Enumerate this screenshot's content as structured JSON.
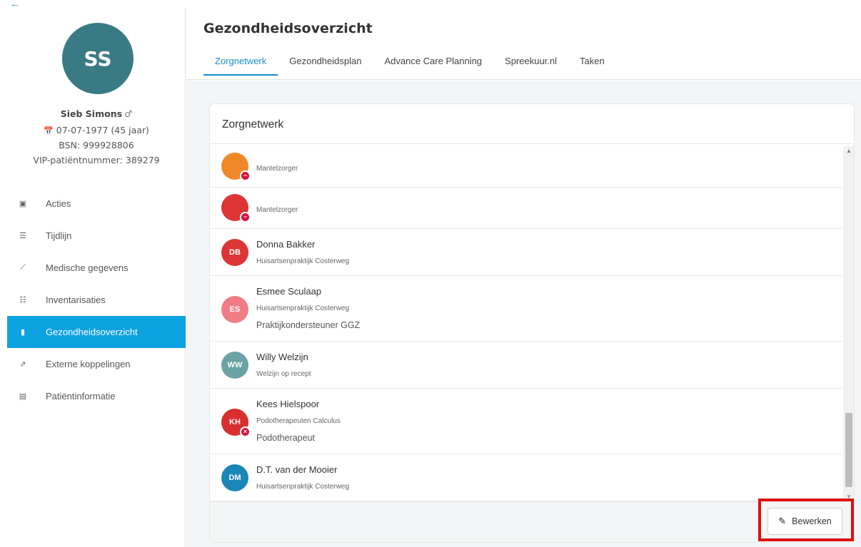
{
  "nav_back_icon": "arrow-left-icon",
  "patient": {
    "initials": "SS",
    "avatar_color": "#3a7a85",
    "name": "Sieb Simons",
    "gender_symbol": "♂",
    "dob": "07-07-1977  (45 jaar)",
    "bsn": "BSN: 999928806",
    "vip": "VIP-patiëntnummer: 389279"
  },
  "sidebar": {
    "items": [
      {
        "label": "Acties",
        "icon": "calendar-plus-icon",
        "glyph": "▣"
      },
      {
        "label": "Tijdlijn",
        "icon": "list-icon",
        "glyph": "☰"
      },
      {
        "label": "Medische gegevens",
        "icon": "chart-line-icon",
        "glyph": "⟋"
      },
      {
        "label": "Inventarisaties",
        "icon": "checklist-icon",
        "glyph": "☷"
      },
      {
        "label": "Gezondheidsoverzicht",
        "icon": "document-icon",
        "glyph": "▮",
        "active": true
      },
      {
        "label": "Externe koppelingen",
        "icon": "external-link-icon",
        "glyph": "⇗"
      },
      {
        "label": "Patiëntinformatie",
        "icon": "id-card-icon",
        "glyph": "▤"
      }
    ]
  },
  "header": {
    "title": "Gezondheidsoverzicht",
    "tabs": [
      {
        "label": "Zorgnetwerk",
        "active": true
      },
      {
        "label": "Gezondheidsplan"
      },
      {
        "label": "Advance Care Planning"
      },
      {
        "label": "Spreekuur.nl"
      },
      {
        "label": "Taken"
      }
    ]
  },
  "card": {
    "title": "Zorgnetwerk",
    "edit_label": "Bewerken",
    "edit_icon": "pencil-icon",
    "rows": [
      {
        "initials": "",
        "color": "#f0882a",
        "name": "",
        "org": "Mantelzorger",
        "role": "",
        "badge": "minus"
      },
      {
        "initials": "",
        "color": "#dd3535",
        "name": "",
        "org": "Mantelzorger",
        "role": "",
        "badge": "minus"
      },
      {
        "initials": "DB",
        "color": "#dd3535",
        "name": "Donna Bakker",
        "org": "Huisartsenpraktijk Costerweg",
        "role": "",
        "badge": ""
      },
      {
        "initials": "ES",
        "color": "#f07d86",
        "name": "Esmee Sculaap",
        "org": "Huisartsenpraktijk Costerweg",
        "role": "Praktijkondersteuner GGZ",
        "badge": ""
      },
      {
        "initials": "WW",
        "color": "#6ba2a6",
        "name": "Willy Welzijn",
        "org": "Welzijn op recept",
        "role": "",
        "badge": ""
      },
      {
        "initials": "KH",
        "color": "#d92f2f",
        "name": "Kees Hielspoor",
        "org": "Podotherapeuten Calculus",
        "role": "Podotherapeut",
        "badge": "x"
      },
      {
        "initials": "DM",
        "color": "#1b86b8",
        "name": "D.T. van der Mooier",
        "org": "Huisartsenpraktijk Costerweg",
        "role": "",
        "badge": ""
      }
    ]
  },
  "colors": {
    "accent": "#0da2e0",
    "tab_active": "#1a8cc9",
    "badge_red": "#d1163b",
    "highlight": "#e01010"
  }
}
